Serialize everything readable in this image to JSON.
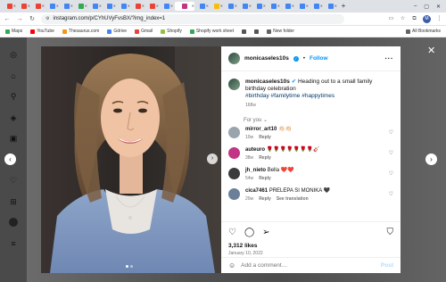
{
  "browser": {
    "url": "instagram.com/p/CYhUVyFvsBX/?img_index=1",
    "tabs": [
      {
        "color": "#ea4335"
      },
      {
        "color": "#ea4335"
      },
      {
        "color": "#ea4335"
      },
      {
        "color": "#4285f4"
      },
      {
        "color": "#4285f4"
      },
      {
        "color": "#34a853"
      },
      {
        "color": "#4285f4"
      },
      {
        "color": "#4285f4"
      },
      {
        "color": "#4285f4"
      },
      {
        "color": "#ea4335"
      },
      {
        "color": "#ea4335"
      },
      {
        "color": "#4285f4"
      },
      {
        "color": "#c13584",
        "active": true
      },
      {
        "color": "#4285f4"
      },
      {
        "color": "#fbbc05"
      },
      {
        "color": "#4285f4"
      },
      {
        "color": "#4285f4"
      },
      {
        "color": "#4285f4"
      },
      {
        "color": "#4285f4"
      },
      {
        "color": "#4285f4"
      },
      {
        "color": "#4285f4"
      },
      {
        "color": "#4285f4"
      },
      {
        "color": "#4285f4"
      }
    ],
    "profile_initial": "M",
    "bookmarks": [
      {
        "label": "Maps",
        "color": "#34a853"
      },
      {
        "label": "YouTube",
        "color": "#ff0000"
      },
      {
        "label": "Thesaurus.com",
        "color": "#f7931e"
      },
      {
        "label": "Gdrive",
        "color": "#4285f4"
      },
      {
        "label": "Gmail",
        "color": "#ea4335"
      },
      {
        "label": "Shopify",
        "color": "#96bf48"
      },
      {
        "label": "Shopify work sheet",
        "color": "#34a853"
      },
      {
        "label": "",
        "color": "#555555"
      },
      {
        "label": "",
        "color": "#555555"
      },
      {
        "label": "New folder",
        "color": "#5f6368"
      }
    ],
    "all_bookmarks": "All Bookmarks"
  },
  "post": {
    "username": "monicaseles10s",
    "follow": "Follow",
    "caption": "Heading out to a small family birthday celebration",
    "hashtags": "#birthday #familytime #happytimes",
    "caption_time": "168w",
    "for_you": "For you",
    "comments": [
      {
        "user": "mirror_art10",
        "text": "👏🏻👏🏻",
        "time": "10w",
        "reply": "Reply",
        "color": "#9aa4ad",
        "see_translation": ""
      },
      {
        "user": "auteuro",
        "text": "🌹🌹🌹🌹🌹🌹🌹🎸",
        "time": "38w",
        "reply": "Reply",
        "color": "#c13584",
        "see_translation": ""
      },
      {
        "user": "jh_nieto",
        "text": "Bella ❤️❤️",
        "time": "54w",
        "reply": "Reply",
        "color": "#3b3b3b",
        "see_translation": ""
      },
      {
        "user": "cica7461",
        "text": "PRELEPA SI MONIKA 🖤",
        "time": "20w",
        "reply": "Reply",
        "color": "#6b7f99",
        "see_translation": "See translation"
      }
    ],
    "likes": "3,312 likes",
    "date": "January 10, 2022",
    "add_comment_placeholder": "Add a comment…",
    "post_button": "Post"
  }
}
